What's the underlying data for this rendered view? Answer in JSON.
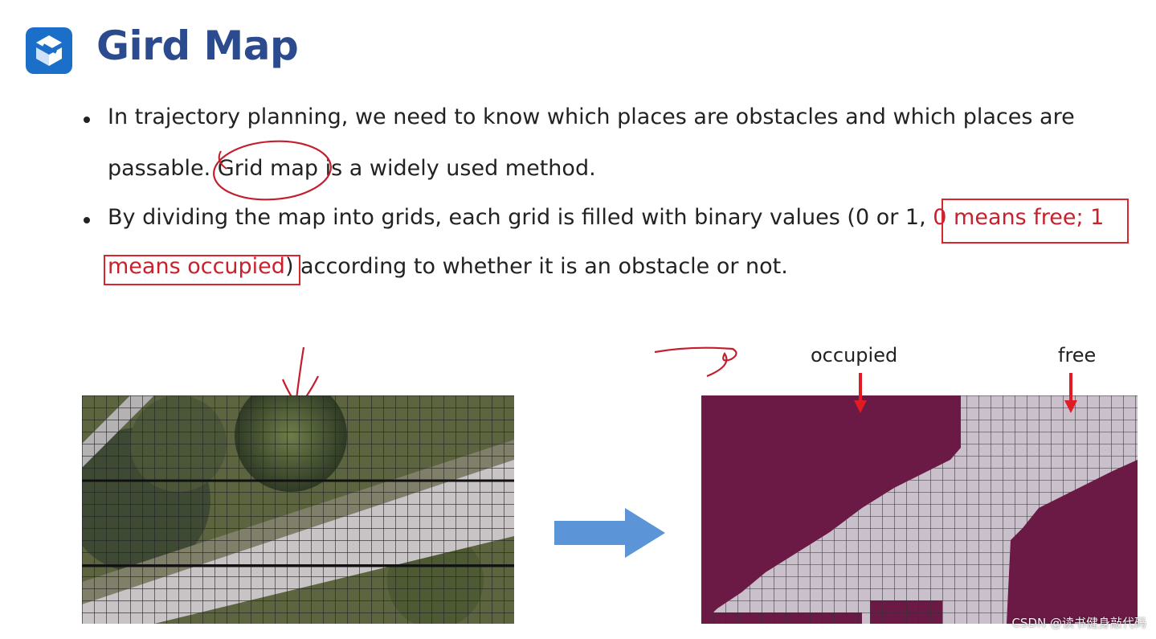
{
  "slide": {
    "title": "Gird Map",
    "bullets": {
      "b1_line1": "In trajectory planning, we need to know which places are obstacles and which places are",
      "b1_line2_pre": "passable.",
      "b1_line2_hl": "Grid map",
      "b1_line2_post": "is a widely used method.",
      "b2_line1_pre": "By dividing the map into grids, each grid is filled with binary values (0 or 1,",
      "b2_line1_red": "0 means free; 1",
      "b2_line2_red": "means occupied",
      "b2_line2_post": ") according to whether it is an obstacle or not."
    },
    "labels": {
      "occupied": "occupied",
      "free": "free"
    },
    "watermark": "CSDN @读书健身敲代码"
  },
  "colors": {
    "title": "#2b4b8e",
    "logo": "#1b6fc9",
    "annotation_red": "#d8262f",
    "occupied_fill": "#6a1a45",
    "free_fill": "#c9c0cc",
    "arrow_blue": "#5b95d8"
  },
  "icons": {
    "logo": "cube-logo-icon",
    "arrow": "right-arrow-icon"
  }
}
